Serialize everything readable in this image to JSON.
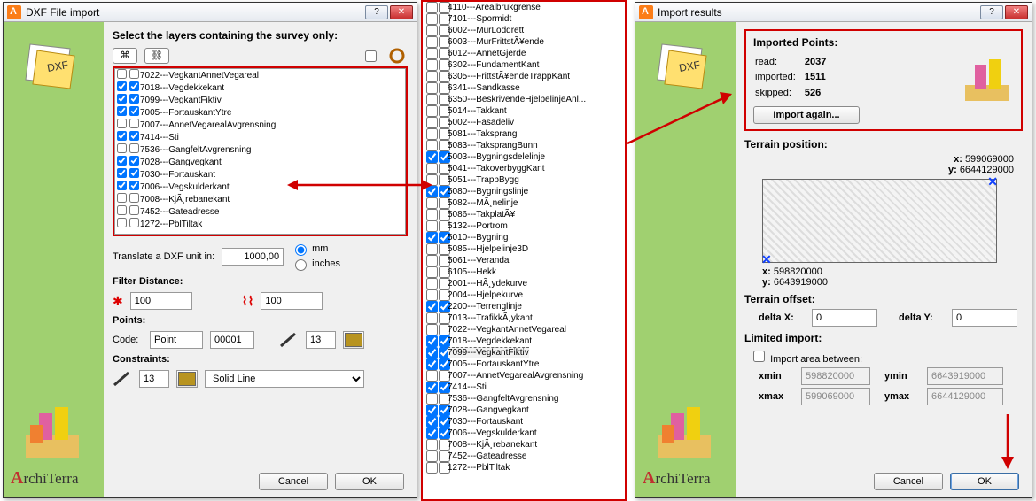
{
  "dialog1": {
    "title": "DXF File import",
    "instruction": "Select the layers containing the survey only:",
    "layers": [
      {
        "c1": false,
        "c2": false,
        "name": "7022---VegkantAnnetVegareal"
      },
      {
        "c1": true,
        "c2": true,
        "name": "7018---Vegdekkekant"
      },
      {
        "c1": true,
        "c2": true,
        "name": "7099---VegkantFiktiv"
      },
      {
        "c1": true,
        "c2": true,
        "name": "7005---FortauskantYtre"
      },
      {
        "c1": false,
        "c2": false,
        "name": "7007---AnnetVegarealAvgrensning"
      },
      {
        "c1": true,
        "c2": true,
        "name": "7414---Sti"
      },
      {
        "c1": false,
        "c2": false,
        "name": "7536---GangfeltAvgrensning"
      },
      {
        "c1": true,
        "c2": true,
        "name": "7028---Gangvegkant"
      },
      {
        "c1": true,
        "c2": true,
        "name": "7030---Fortauskant"
      },
      {
        "c1": true,
        "c2": true,
        "name": "7006---Vegskulderkant"
      },
      {
        "c1": false,
        "c2": false,
        "name": "7008---KjÃ¸rebanekant"
      },
      {
        "c1": false,
        "c2": false,
        "name": "7452---Gateadresse"
      },
      {
        "c1": false,
        "c2": false,
        "name": "1272---PblTiltak"
      }
    ],
    "translate_label": "Translate a DXF unit in:",
    "translate_value": "1000,00",
    "unit_mm": "mm",
    "unit_inches": "inches",
    "filter_label": "Filter Distance:",
    "filter_val1": "100",
    "filter_val2": "100",
    "points_label": "Points:",
    "code_label": "Code:",
    "code_value": "Point",
    "code_num": "00001",
    "pen_value": "13",
    "constraints_label": "Constraints:",
    "cons_value": "13",
    "line_style": "Solid Line",
    "cancel": "Cancel",
    "ok": "OK"
  },
  "mid_layers": [
    {
      "c1": false,
      "c2": false,
      "name": "4110---Arealbrukgrense"
    },
    {
      "c1": false,
      "c2": false,
      "name": "7101---Spormidt"
    },
    {
      "c1": false,
      "c2": false,
      "name": "6002---MurLoddrett"
    },
    {
      "c1": false,
      "c2": false,
      "name": "6003---MurFrittstÃ¥ende"
    },
    {
      "c1": false,
      "c2": false,
      "name": "6012---AnnetGjerde"
    },
    {
      "c1": false,
      "c2": false,
      "name": "6302---FundamentKant"
    },
    {
      "c1": false,
      "c2": false,
      "name": "6305---FrittstÃ¥endeTrappKant"
    },
    {
      "c1": false,
      "c2": false,
      "name": "6341---Sandkasse"
    },
    {
      "c1": false,
      "c2": false,
      "name": "6350---BeskrivendeHjelpelinjeAnl..."
    },
    {
      "c1": false,
      "c2": false,
      "name": "5014---Takkant"
    },
    {
      "c1": false,
      "c2": false,
      "name": "5002---Fasadeliv"
    },
    {
      "c1": false,
      "c2": false,
      "name": "5081---Taksprang"
    },
    {
      "c1": false,
      "c2": false,
      "name": "5083---TaksprangBunn"
    },
    {
      "c1": true,
      "c2": true,
      "name": "5003---Bygningsdelelinje"
    },
    {
      "c1": false,
      "c2": false,
      "name": "5041---TakoverbyggKant"
    },
    {
      "c1": false,
      "c2": false,
      "name": "5051---TrappBygg"
    },
    {
      "c1": true,
      "c2": true,
      "name": "5080---Bygningslinje"
    },
    {
      "c1": false,
      "c2": false,
      "name": "5082---MÃ¸nelinje"
    },
    {
      "c1": false,
      "c2": false,
      "name": "5086---TakplatÃ¥"
    },
    {
      "c1": false,
      "c2": false,
      "name": "5132---Portrom"
    },
    {
      "c1": true,
      "c2": true,
      "name": "5010---Bygning"
    },
    {
      "c1": false,
      "c2": false,
      "name": "5085---Hjelpelinje3D"
    },
    {
      "c1": false,
      "c2": false,
      "name": "5061---Veranda"
    },
    {
      "c1": false,
      "c2": false,
      "name": "6105---Hekk"
    },
    {
      "c1": false,
      "c2": false,
      "name": "2001---HÃ¸ydekurve"
    },
    {
      "c1": false,
      "c2": false,
      "name": "2004---Hjelpekurve"
    },
    {
      "c1": true,
      "c2": true,
      "name": "2200---Terrenglinje"
    },
    {
      "c1": false,
      "c2": false,
      "name": "7013---TrafikkÃ¸ykant"
    },
    {
      "c1": false,
      "c2": false,
      "name": "7022---VegkantAnnetVegareal"
    },
    {
      "c1": true,
      "c2": true,
      "name": "7018---Vegdekkekant"
    },
    {
      "c1": true,
      "c2": true,
      "name": "7099---VegkantFiktiv",
      "dashed": true
    },
    {
      "c1": true,
      "c2": true,
      "name": "7005---FortauskantYtre"
    },
    {
      "c1": false,
      "c2": false,
      "name": "7007---AnnetVegarealAvgrensning"
    },
    {
      "c1": true,
      "c2": true,
      "name": "7414---Sti"
    },
    {
      "c1": false,
      "c2": false,
      "name": "7536---GangfeltAvgrensning"
    },
    {
      "c1": true,
      "c2": true,
      "name": "7028---Gangvegkant"
    },
    {
      "c1": true,
      "c2": true,
      "name": "7030---Fortauskant"
    },
    {
      "c1": true,
      "c2": true,
      "name": "7006---Vegskulderkant"
    },
    {
      "c1": false,
      "c2": false,
      "name": "7008---KjÃ¸rebanekant"
    },
    {
      "c1": false,
      "c2": false,
      "name": "7452---Gateadresse"
    },
    {
      "c1": false,
      "c2": false,
      "name": "1272---PblTiltak"
    }
  ],
  "dialog2": {
    "title": "Import results",
    "imported_heading": "Imported Points:",
    "read_lbl": "read:",
    "read_val": "2037",
    "imp_lbl": "imported:",
    "imp_val": "1511",
    "skip_lbl": "skipped:",
    "skip_val": "526",
    "import_again": "Import again...",
    "terrain_pos": "Terrain position:",
    "x1_lbl": "x:",
    "x1_val": "599069000",
    "y1_lbl": "y:",
    "y1_val": "6644129000",
    "x2_lbl": "x:",
    "x2_val": "598820000",
    "y2_lbl": "y:",
    "y2_val": "6643919000",
    "terrain_offset": "Terrain offset:",
    "dx_lbl": "delta X:",
    "dx_val": "0",
    "dy_lbl": "delta Y:",
    "dy_val": "0",
    "limited_import": "Limited import:",
    "area_between": "Import area between:",
    "xmin_lbl": "xmin",
    "xmin_val": "598820000",
    "ymin_lbl": "ymin",
    "ymin_val": "6643919000",
    "xmax_lbl": "xmax",
    "xmax_val": "599069000",
    "ymax_lbl": "ymax",
    "ymax_val": "6644129000",
    "cancel": "Cancel",
    "ok": "OK"
  },
  "brand": "ArchiTerra"
}
